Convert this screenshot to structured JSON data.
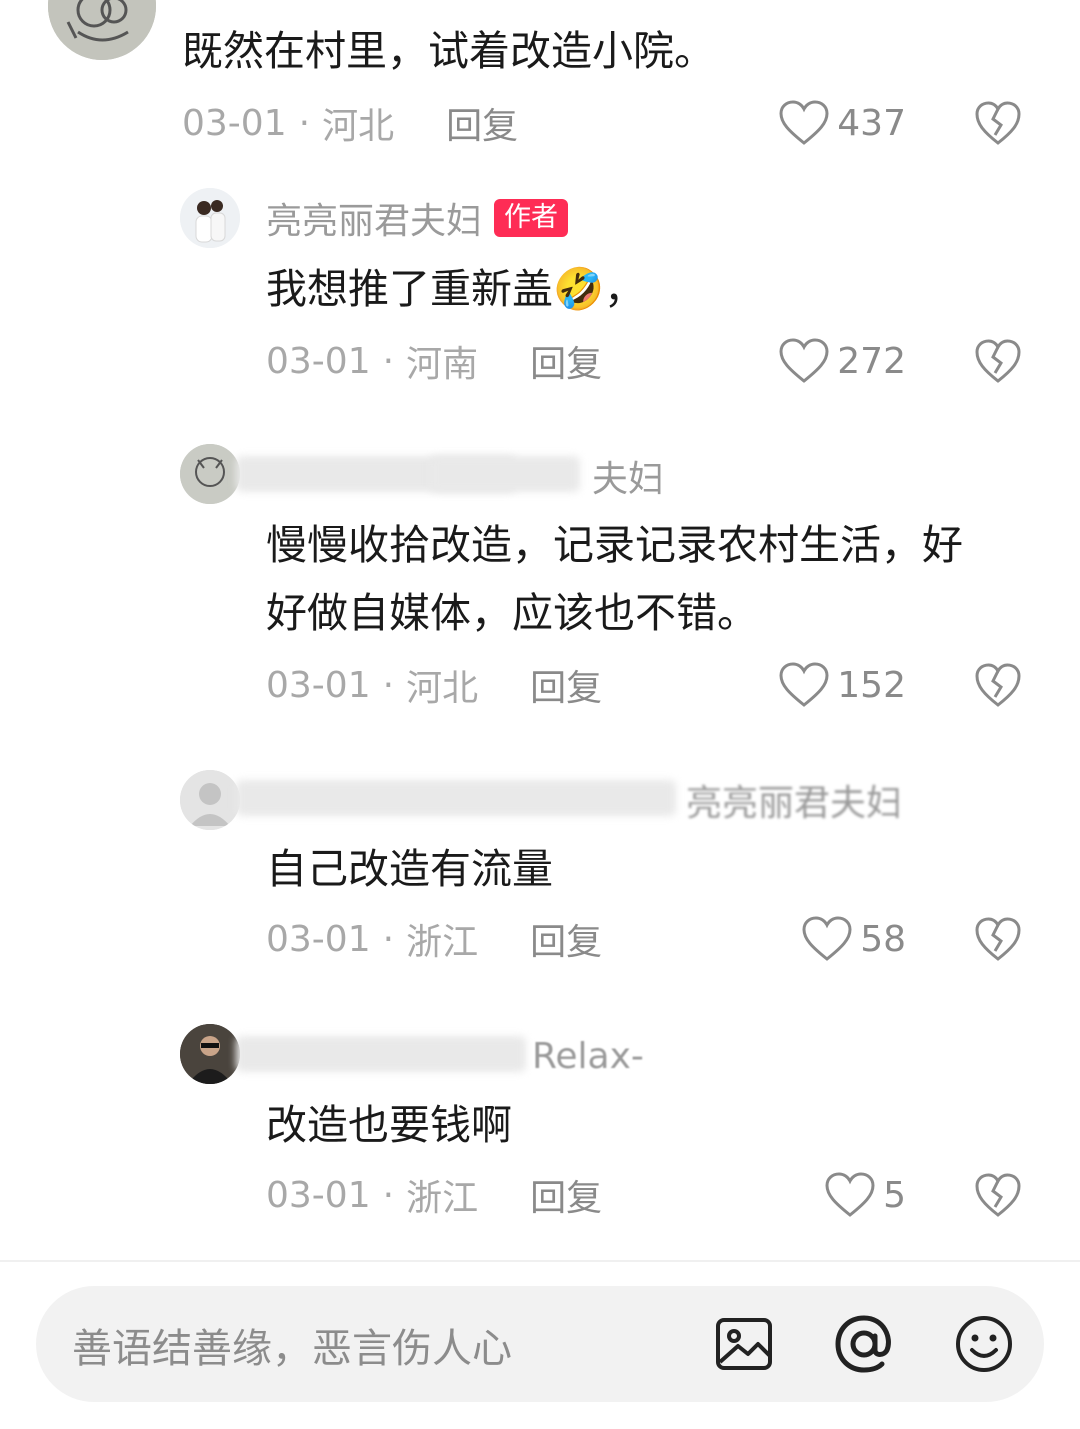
{
  "comments": [
    {
      "text": "既然在村里，试着改造小院。",
      "date": "03-01",
      "location": "河北",
      "reply_label": "回复",
      "likes": "437"
    },
    {
      "name": "亮亮丽君夫妇",
      "badge": "作者",
      "text": "我想推了重新盖🤣，",
      "date": "03-01",
      "location": "河南",
      "reply_label": "回复",
      "likes": "272"
    },
    {
      "name_visible": "夫妇",
      "text_line1": "慢慢收拾改造，记录记录农村生活，好",
      "text_line2": "好做自媒体，应该也不错。",
      "date": "03-01",
      "location": "河北",
      "reply_label": "回复",
      "likes": "152"
    },
    {
      "name_visible": "亮亮丽君夫妇",
      "text": "自己改造有流量",
      "date": "03-01",
      "location": "浙江",
      "reply_label": "回复",
      "likes": "58"
    },
    {
      "name_visible": "Relax-",
      "text": "改造也要钱啊",
      "date": "03-01",
      "location": "浙江",
      "reply_label": "回复",
      "likes": "5"
    }
  ],
  "input_bar": {
    "placeholder": "善语结善缘，恶言伤人心",
    "icons": [
      "image-icon",
      "at-icon",
      "emoji-icon"
    ]
  },
  "meta_separator": "·",
  "colors": {
    "author_badge": "#fe2c55",
    "meta_text": "#9a9a9a",
    "input_background": "#f2f2f2"
  }
}
